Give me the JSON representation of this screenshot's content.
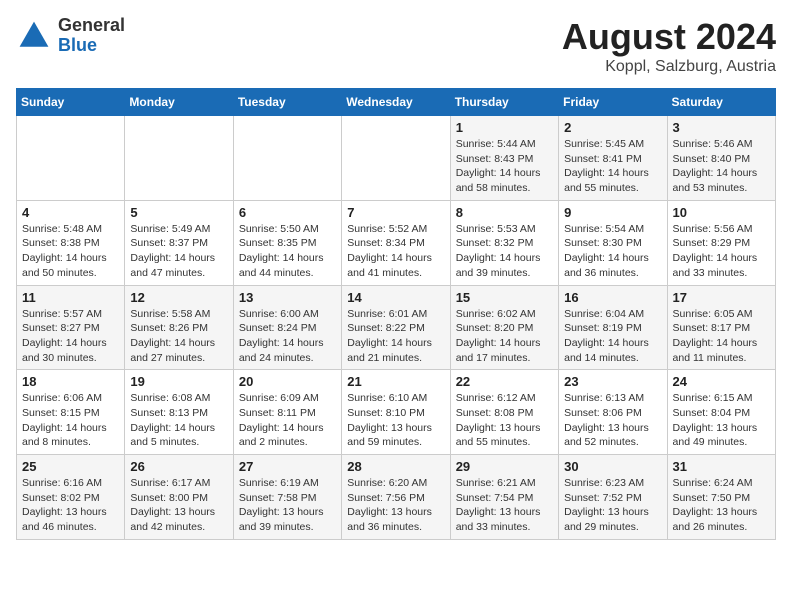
{
  "header": {
    "logo_general": "General",
    "logo_blue": "Blue",
    "title": "August 2024",
    "subtitle": "Koppl, Salzburg, Austria"
  },
  "weekdays": [
    "Sunday",
    "Monday",
    "Tuesday",
    "Wednesday",
    "Thursday",
    "Friday",
    "Saturday"
  ],
  "weeks": [
    [
      {
        "day": "",
        "info": ""
      },
      {
        "day": "",
        "info": ""
      },
      {
        "day": "",
        "info": ""
      },
      {
        "day": "",
        "info": ""
      },
      {
        "day": "1",
        "info": "Sunrise: 5:44 AM\nSunset: 8:43 PM\nDaylight: 14 hours\nand 58 minutes."
      },
      {
        "day": "2",
        "info": "Sunrise: 5:45 AM\nSunset: 8:41 PM\nDaylight: 14 hours\nand 55 minutes."
      },
      {
        "day": "3",
        "info": "Sunrise: 5:46 AM\nSunset: 8:40 PM\nDaylight: 14 hours\nand 53 minutes."
      }
    ],
    [
      {
        "day": "4",
        "info": "Sunrise: 5:48 AM\nSunset: 8:38 PM\nDaylight: 14 hours\nand 50 minutes."
      },
      {
        "day": "5",
        "info": "Sunrise: 5:49 AM\nSunset: 8:37 PM\nDaylight: 14 hours\nand 47 minutes."
      },
      {
        "day": "6",
        "info": "Sunrise: 5:50 AM\nSunset: 8:35 PM\nDaylight: 14 hours\nand 44 minutes."
      },
      {
        "day": "7",
        "info": "Sunrise: 5:52 AM\nSunset: 8:34 PM\nDaylight: 14 hours\nand 41 minutes."
      },
      {
        "day": "8",
        "info": "Sunrise: 5:53 AM\nSunset: 8:32 PM\nDaylight: 14 hours\nand 39 minutes."
      },
      {
        "day": "9",
        "info": "Sunrise: 5:54 AM\nSunset: 8:30 PM\nDaylight: 14 hours\nand 36 minutes."
      },
      {
        "day": "10",
        "info": "Sunrise: 5:56 AM\nSunset: 8:29 PM\nDaylight: 14 hours\nand 33 minutes."
      }
    ],
    [
      {
        "day": "11",
        "info": "Sunrise: 5:57 AM\nSunset: 8:27 PM\nDaylight: 14 hours\nand 30 minutes."
      },
      {
        "day": "12",
        "info": "Sunrise: 5:58 AM\nSunset: 8:26 PM\nDaylight: 14 hours\nand 27 minutes."
      },
      {
        "day": "13",
        "info": "Sunrise: 6:00 AM\nSunset: 8:24 PM\nDaylight: 14 hours\nand 24 minutes."
      },
      {
        "day": "14",
        "info": "Sunrise: 6:01 AM\nSunset: 8:22 PM\nDaylight: 14 hours\nand 21 minutes."
      },
      {
        "day": "15",
        "info": "Sunrise: 6:02 AM\nSunset: 8:20 PM\nDaylight: 14 hours\nand 17 minutes."
      },
      {
        "day": "16",
        "info": "Sunrise: 6:04 AM\nSunset: 8:19 PM\nDaylight: 14 hours\nand 14 minutes."
      },
      {
        "day": "17",
        "info": "Sunrise: 6:05 AM\nSunset: 8:17 PM\nDaylight: 14 hours\nand 11 minutes."
      }
    ],
    [
      {
        "day": "18",
        "info": "Sunrise: 6:06 AM\nSunset: 8:15 PM\nDaylight: 14 hours\nand 8 minutes."
      },
      {
        "day": "19",
        "info": "Sunrise: 6:08 AM\nSunset: 8:13 PM\nDaylight: 14 hours\nand 5 minutes."
      },
      {
        "day": "20",
        "info": "Sunrise: 6:09 AM\nSunset: 8:11 PM\nDaylight: 14 hours\nand 2 minutes."
      },
      {
        "day": "21",
        "info": "Sunrise: 6:10 AM\nSunset: 8:10 PM\nDaylight: 13 hours\nand 59 minutes."
      },
      {
        "day": "22",
        "info": "Sunrise: 6:12 AM\nSunset: 8:08 PM\nDaylight: 13 hours\nand 55 minutes."
      },
      {
        "day": "23",
        "info": "Sunrise: 6:13 AM\nSunset: 8:06 PM\nDaylight: 13 hours\nand 52 minutes."
      },
      {
        "day": "24",
        "info": "Sunrise: 6:15 AM\nSunset: 8:04 PM\nDaylight: 13 hours\nand 49 minutes."
      }
    ],
    [
      {
        "day": "25",
        "info": "Sunrise: 6:16 AM\nSunset: 8:02 PM\nDaylight: 13 hours\nand 46 minutes."
      },
      {
        "day": "26",
        "info": "Sunrise: 6:17 AM\nSunset: 8:00 PM\nDaylight: 13 hours\nand 42 minutes."
      },
      {
        "day": "27",
        "info": "Sunrise: 6:19 AM\nSunset: 7:58 PM\nDaylight: 13 hours\nand 39 minutes."
      },
      {
        "day": "28",
        "info": "Sunrise: 6:20 AM\nSunset: 7:56 PM\nDaylight: 13 hours\nand 36 minutes."
      },
      {
        "day": "29",
        "info": "Sunrise: 6:21 AM\nSunset: 7:54 PM\nDaylight: 13 hours\nand 33 minutes."
      },
      {
        "day": "30",
        "info": "Sunrise: 6:23 AM\nSunset: 7:52 PM\nDaylight: 13 hours\nand 29 minutes."
      },
      {
        "day": "31",
        "info": "Sunrise: 6:24 AM\nSunset: 7:50 PM\nDaylight: 13 hours\nand 26 minutes."
      }
    ]
  ]
}
